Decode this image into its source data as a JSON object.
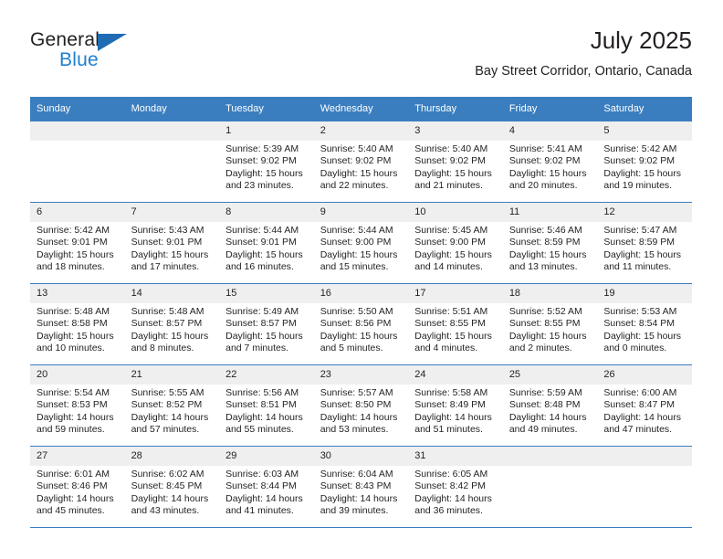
{
  "brand": {
    "name_part1": "General",
    "name_part2": "Blue",
    "triangle_icon": "triangle-icon",
    "accent_color": "#1f7fd0",
    "header_color": "#3a7ebf"
  },
  "header": {
    "title": "July 2025",
    "subtitle": "Bay Street Corridor, Ontario, Canada"
  },
  "calendar": {
    "weekday_headers": [
      "Sunday",
      "Monday",
      "Tuesday",
      "Wednesday",
      "Thursday",
      "Friday",
      "Saturday"
    ],
    "labels": {
      "sunrise": "Sunrise:",
      "sunset": "Sunset:",
      "daylight": "Daylight:"
    },
    "weeks": [
      [
        {
          "day": "",
          "blank": true
        },
        {
          "day": "",
          "blank": true
        },
        {
          "day": "1",
          "sunrise": "Sunrise: 5:39 AM",
          "sunset": "Sunset: 9:02 PM",
          "daylight_line1": "Daylight: 15 hours",
          "daylight_line2": "and 23 minutes."
        },
        {
          "day": "2",
          "sunrise": "Sunrise: 5:40 AM",
          "sunset": "Sunset: 9:02 PM",
          "daylight_line1": "Daylight: 15 hours",
          "daylight_line2": "and 22 minutes."
        },
        {
          "day": "3",
          "sunrise": "Sunrise: 5:40 AM",
          "sunset": "Sunset: 9:02 PM",
          "daylight_line1": "Daylight: 15 hours",
          "daylight_line2": "and 21 minutes."
        },
        {
          "day": "4",
          "sunrise": "Sunrise: 5:41 AM",
          "sunset": "Sunset: 9:02 PM",
          "daylight_line1": "Daylight: 15 hours",
          "daylight_line2": "and 20 minutes."
        },
        {
          "day": "5",
          "sunrise": "Sunrise: 5:42 AM",
          "sunset": "Sunset: 9:02 PM",
          "daylight_line1": "Daylight: 15 hours",
          "daylight_line2": "and 19 minutes."
        }
      ],
      [
        {
          "day": "6",
          "sunrise": "Sunrise: 5:42 AM",
          "sunset": "Sunset: 9:01 PM",
          "daylight_line1": "Daylight: 15 hours",
          "daylight_line2": "and 18 minutes."
        },
        {
          "day": "7",
          "sunrise": "Sunrise: 5:43 AM",
          "sunset": "Sunset: 9:01 PM",
          "daylight_line1": "Daylight: 15 hours",
          "daylight_line2": "and 17 minutes."
        },
        {
          "day": "8",
          "sunrise": "Sunrise: 5:44 AM",
          "sunset": "Sunset: 9:01 PM",
          "daylight_line1": "Daylight: 15 hours",
          "daylight_line2": "and 16 minutes."
        },
        {
          "day": "9",
          "sunrise": "Sunrise: 5:44 AM",
          "sunset": "Sunset: 9:00 PM",
          "daylight_line1": "Daylight: 15 hours",
          "daylight_line2": "and 15 minutes."
        },
        {
          "day": "10",
          "sunrise": "Sunrise: 5:45 AM",
          "sunset": "Sunset: 9:00 PM",
          "daylight_line1": "Daylight: 15 hours",
          "daylight_line2": "and 14 minutes."
        },
        {
          "day": "11",
          "sunrise": "Sunrise: 5:46 AM",
          "sunset": "Sunset: 8:59 PM",
          "daylight_line1": "Daylight: 15 hours",
          "daylight_line2": "and 13 minutes."
        },
        {
          "day": "12",
          "sunrise": "Sunrise: 5:47 AM",
          "sunset": "Sunset: 8:59 PM",
          "daylight_line1": "Daylight: 15 hours",
          "daylight_line2": "and 11 minutes."
        }
      ],
      [
        {
          "day": "13",
          "sunrise": "Sunrise: 5:48 AM",
          "sunset": "Sunset: 8:58 PM",
          "daylight_line1": "Daylight: 15 hours",
          "daylight_line2": "and 10 minutes."
        },
        {
          "day": "14",
          "sunrise": "Sunrise: 5:48 AM",
          "sunset": "Sunset: 8:57 PM",
          "daylight_line1": "Daylight: 15 hours",
          "daylight_line2": "and 8 minutes."
        },
        {
          "day": "15",
          "sunrise": "Sunrise: 5:49 AM",
          "sunset": "Sunset: 8:57 PM",
          "daylight_line1": "Daylight: 15 hours",
          "daylight_line2": "and 7 minutes."
        },
        {
          "day": "16",
          "sunrise": "Sunrise: 5:50 AM",
          "sunset": "Sunset: 8:56 PM",
          "daylight_line1": "Daylight: 15 hours",
          "daylight_line2": "and 5 minutes."
        },
        {
          "day": "17",
          "sunrise": "Sunrise: 5:51 AM",
          "sunset": "Sunset: 8:55 PM",
          "daylight_line1": "Daylight: 15 hours",
          "daylight_line2": "and 4 minutes."
        },
        {
          "day": "18",
          "sunrise": "Sunrise: 5:52 AM",
          "sunset": "Sunset: 8:55 PM",
          "daylight_line1": "Daylight: 15 hours",
          "daylight_line2": "and 2 minutes."
        },
        {
          "day": "19",
          "sunrise": "Sunrise: 5:53 AM",
          "sunset": "Sunset: 8:54 PM",
          "daylight_line1": "Daylight: 15 hours",
          "daylight_line2": "and 0 minutes."
        }
      ],
      [
        {
          "day": "20",
          "sunrise": "Sunrise: 5:54 AM",
          "sunset": "Sunset: 8:53 PM",
          "daylight_line1": "Daylight: 14 hours",
          "daylight_line2": "and 59 minutes."
        },
        {
          "day": "21",
          "sunrise": "Sunrise: 5:55 AM",
          "sunset": "Sunset: 8:52 PM",
          "daylight_line1": "Daylight: 14 hours",
          "daylight_line2": "and 57 minutes."
        },
        {
          "day": "22",
          "sunrise": "Sunrise: 5:56 AM",
          "sunset": "Sunset: 8:51 PM",
          "daylight_line1": "Daylight: 14 hours",
          "daylight_line2": "and 55 minutes."
        },
        {
          "day": "23",
          "sunrise": "Sunrise: 5:57 AM",
          "sunset": "Sunset: 8:50 PM",
          "daylight_line1": "Daylight: 14 hours",
          "daylight_line2": "and 53 minutes."
        },
        {
          "day": "24",
          "sunrise": "Sunrise: 5:58 AM",
          "sunset": "Sunset: 8:49 PM",
          "daylight_line1": "Daylight: 14 hours",
          "daylight_line2": "and 51 minutes."
        },
        {
          "day": "25",
          "sunrise": "Sunrise: 5:59 AM",
          "sunset": "Sunset: 8:48 PM",
          "daylight_line1": "Daylight: 14 hours",
          "daylight_line2": "and 49 minutes."
        },
        {
          "day": "26",
          "sunrise": "Sunrise: 6:00 AM",
          "sunset": "Sunset: 8:47 PM",
          "daylight_line1": "Daylight: 14 hours",
          "daylight_line2": "and 47 minutes."
        }
      ],
      [
        {
          "day": "27",
          "sunrise": "Sunrise: 6:01 AM",
          "sunset": "Sunset: 8:46 PM",
          "daylight_line1": "Daylight: 14 hours",
          "daylight_line2": "and 45 minutes."
        },
        {
          "day": "28",
          "sunrise": "Sunrise: 6:02 AM",
          "sunset": "Sunset: 8:45 PM",
          "daylight_line1": "Daylight: 14 hours",
          "daylight_line2": "and 43 minutes."
        },
        {
          "day": "29",
          "sunrise": "Sunrise: 6:03 AM",
          "sunset": "Sunset: 8:44 PM",
          "daylight_line1": "Daylight: 14 hours",
          "daylight_line2": "and 41 minutes."
        },
        {
          "day": "30",
          "sunrise": "Sunrise: 6:04 AM",
          "sunset": "Sunset: 8:43 PM",
          "daylight_line1": "Daylight: 14 hours",
          "daylight_line2": "and 39 minutes."
        },
        {
          "day": "31",
          "sunrise": "Sunrise: 6:05 AM",
          "sunset": "Sunset: 8:42 PM",
          "daylight_line1": "Daylight: 14 hours",
          "daylight_line2": "and 36 minutes."
        },
        {
          "day": "",
          "blank": true
        },
        {
          "day": "",
          "blank": true
        }
      ]
    ]
  }
}
